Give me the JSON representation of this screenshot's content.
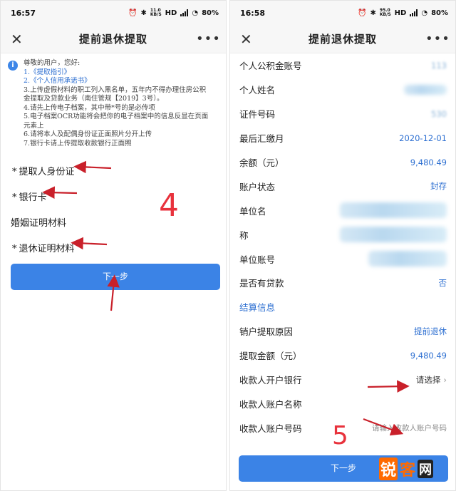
{
  "left": {
    "status": {
      "time": "16:57",
      "net": "11.0\nKB/S",
      "battery": "80%"
    },
    "nav": {
      "close": "✕",
      "title": "提前退休提取",
      "more": "•••"
    },
    "notice": {
      "info": "i",
      "lines": [
        "尊敬的用户，您好:",
        "1.《提取指引》",
        "2.《个人信用承诺书》",
        "3.上传虚假材料的职工列入黑名单，五年内不得办理住房公积",
        "金提取及贷款业务（南住管规【2019】3号）。",
        "4.请先上传电子档案，其中带*号的是必传项",
        "5.电子档案OCR功能将会把你的电子档案中的信息反显在页面",
        "元素上",
        "6.请将本人及配偶身份证正面照片分开上传",
        "7.银行卡请上传提取收款银行正面照"
      ]
    },
    "fields": {
      "id_card": {
        "star": "*",
        "label": "提取人身份证"
      },
      "bank_card": {
        "star": "*",
        "label": "银行卡"
      },
      "marriage": {
        "label": "婚姻证明材料"
      },
      "retire": {
        "star": "*",
        "label": "退休证明材料"
      }
    },
    "next_button": "下一步",
    "annotation": "4"
  },
  "right": {
    "status": {
      "time": "16:58",
      "net": "95.0\nKB/S",
      "battery": "80%"
    },
    "nav": {
      "close": "✕",
      "title": "提前退休提取",
      "more": "•••"
    },
    "rows": {
      "account_no": {
        "label": "个人公积金账号",
        "value": "113"
      },
      "name": {
        "label": "个人姓名"
      },
      "id_no": {
        "label": "证件号码",
        "value": "530"
      },
      "last_paid": {
        "label": "最后汇缴月",
        "value": "2020-12-01"
      },
      "balance": {
        "label": "余额（元）",
        "value": "9,480.49"
      },
      "status": {
        "label": "账户状态",
        "value": "封存"
      },
      "unit_name_1": {
        "label": "单位名"
      },
      "unit_name_2": {
        "label": "称"
      },
      "unit_account": {
        "label": "单位账号"
      },
      "has_loan": {
        "label": "是否有贷款",
        "value": "否"
      },
      "settle": {
        "label": "结算信息"
      },
      "reason": {
        "label": "销户提取原因",
        "value": "提前退休"
      },
      "amount": {
        "label": "提取金额（元）",
        "value": "9,480.49"
      },
      "bank": {
        "label": "收款人开户银行",
        "value": "请选择",
        "chev": "›"
      },
      "payee_name": {
        "label": "收款人账户名称"
      },
      "payee_no": {
        "label": "收款人账户号码",
        "value": "请输入收款人账户号码"
      }
    },
    "next_button": "下一步",
    "annotation": "5"
  },
  "watermark": {
    "a": "锐",
    "b": "客",
    "c": "网"
  },
  "colors": {
    "accent": "#3b83e6",
    "annotation_red": "#e8323c",
    "link_blue": "#2d6fd1"
  }
}
